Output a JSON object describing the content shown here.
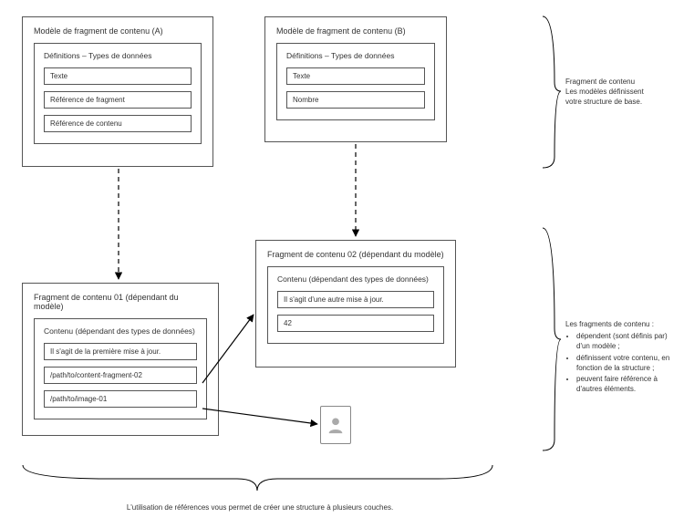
{
  "modelA": {
    "title": "Modèle de fragment de contenu (A)",
    "definitions": {
      "title": "Définitions – Types de données",
      "fields": [
        "Texte",
        "Référence de fragment",
        "Référence de contenu"
      ]
    }
  },
  "modelB": {
    "title": "Modèle de fragment de contenu (B)",
    "definitions": {
      "title": "Définitions – Types de données",
      "fields": [
        "Texte",
        "Nombre"
      ]
    }
  },
  "fragment01": {
    "title": "Fragment de contenu 01 (dépendant du modèle)",
    "content": {
      "title": "Contenu (dépendant des types de données)",
      "fields": [
        "Il s'agit de la première mise à jour.",
        "/path/to/content-fragment-02",
        "/path/to/image-01"
      ]
    }
  },
  "fragment02": {
    "title": "Fragment de contenu 02 (dépendant du modèle)",
    "content": {
      "title": "Contenu (dépendant des types de données)",
      "fields": [
        "Il s'agit d'une autre mise à jour.",
        "42"
      ]
    }
  },
  "annotations": {
    "top": {
      "line1": "Fragment de contenu",
      "line2": "Les modèles définissent",
      "line3": "votre structure de base."
    },
    "bottom": {
      "heading": "Les fragments de contenu :",
      "items": [
        "dépendent (sont définis par) d'un modèle ;",
        "définissent votre contenu, en fonction de la structure ;",
        "peuvent faire référence à d'autres éléments."
      ]
    },
    "caption": "L'utilisation de références vous permet de créer une structure à plusieurs couches."
  }
}
